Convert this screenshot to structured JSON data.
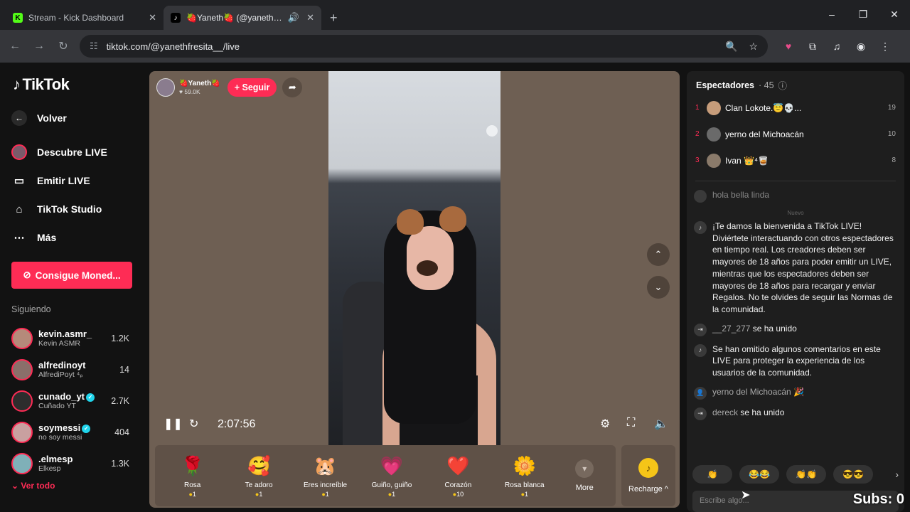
{
  "browser": {
    "tabs": [
      {
        "title": "Stream - Kick Dashboard",
        "favicon": "K",
        "active": false
      },
      {
        "title": "🍓Yaneth🍓 (@yanethfresita__) en TikTok LIVE",
        "favicon": "♪",
        "active": true
      }
    ],
    "new_tab": "+",
    "window_controls": [
      "–",
      "❐",
      "✕"
    ],
    "url": "tiktok.com/@yanethfresita__/live"
  },
  "sidebar": {
    "logo": "TikTok",
    "nav": [
      {
        "icon": "back-icon",
        "label": "Volver"
      },
      {
        "icon": "live-discover-icon",
        "label": "Descubre LIVE"
      },
      {
        "icon": "camera-icon",
        "label": "Emitir LIVE"
      },
      {
        "icon": "house-icon",
        "label": "TikTok Studio"
      },
      {
        "icon": "more-icon",
        "label": "Más"
      }
    ],
    "coins_button": "Consigue Moned...",
    "following_title": "Siguiendo",
    "following": [
      {
        "name": "kevin.asmr_",
        "sub": "Kevin ASMR",
        "count": "1.2K",
        "verified": false,
        "color": "#b58a7a"
      },
      {
        "name": "alfredinoyt",
        "sub": "AlfrediPoyt ⁴ₚ",
        "count": "14",
        "verified": false,
        "color": "#8a6f6a"
      },
      {
        "name": "cunado_yt",
        "sub": "Cuñado YT",
        "count": "2.7K",
        "verified": true,
        "color": "#2d2d2d"
      },
      {
        "name": "soymessi",
        "sub": "no soy messi",
        "count": "404",
        "verified": true,
        "color": "#c9a0a0"
      },
      {
        "name": ".elmesp",
        "sub": "Elkesp",
        "count": "1.3K",
        "verified": false,
        "color": "#7fb0b8"
      }
    ],
    "more_link": "Ver todo"
  },
  "player": {
    "host_name": "🍓Yaneth🍓",
    "host_likes": "59.0K",
    "follow_label": "+ Seguir",
    "time": "2:07:56",
    "gifts": [
      {
        "icon": "🌹",
        "name": "Rosa",
        "cost": "1"
      },
      {
        "icon": "🥰",
        "name": "Te adoro",
        "cost": "1"
      },
      {
        "icon": "🐹",
        "name": "Eres increíble",
        "cost": "1"
      },
      {
        "icon": "💗",
        "name": "Guiño, guiño",
        "cost": "1"
      },
      {
        "icon": "❤️",
        "name": "Corazón",
        "cost": "10"
      },
      {
        "icon": "🌼",
        "name": "Rosa blanca",
        "cost": "1"
      }
    ],
    "more_label": "More",
    "recharge_label": "Recharge ^"
  },
  "chat": {
    "viewers_title": "Espectadores",
    "viewers_count": "· 45",
    "top_viewers": [
      {
        "rank": "1",
        "name": "Clan Lokote.😇💀...",
        "score": "19",
        "color": "#c69c7a"
      },
      {
        "rank": "2",
        "name": "yerno del Michoacán",
        "score": "10",
        "color": "#6a6a6a"
      },
      {
        "rank": "3",
        "name": "Ivan 👑⁴🥃",
        "score": "8",
        "color": "#8a7a6a"
      }
    ],
    "faded_message": "hola bella linda",
    "new_label": "Nuevo",
    "messages": [
      {
        "icon": "♪",
        "user": "",
        "text": "¡Te damos la bienvenida a TikTok LIVE! Diviértete interactuando con otros espectadores en tiempo real. Los creadores deben ser mayores de 18 años para poder emitir un LIVE, mientras que los espectadores deben ser mayores de 18 años para recargar y enviar Regalos. No te olvides de seguir las Normas de la comunidad."
      },
      {
        "icon": "⇥",
        "user": "__27_277",
        "text": "se ha unido"
      },
      {
        "icon": "♪",
        "user": "",
        "text": "Se han omitido algunos comentarios en este LIVE para proteger la experiencia de los usuarios de la comunidad."
      },
      {
        "icon": "👤",
        "user": "yerno del Michoacán",
        "text": "🎉"
      },
      {
        "icon": "⇥",
        "user": "dereck",
        "text": "se ha unido"
      }
    ],
    "quick_reactions": [
      "👏",
      "😂😂",
      "👏👏",
      "😎😎"
    ],
    "input_placeholder": "Escribe algo...",
    "overlay": "Subs: 0"
  }
}
